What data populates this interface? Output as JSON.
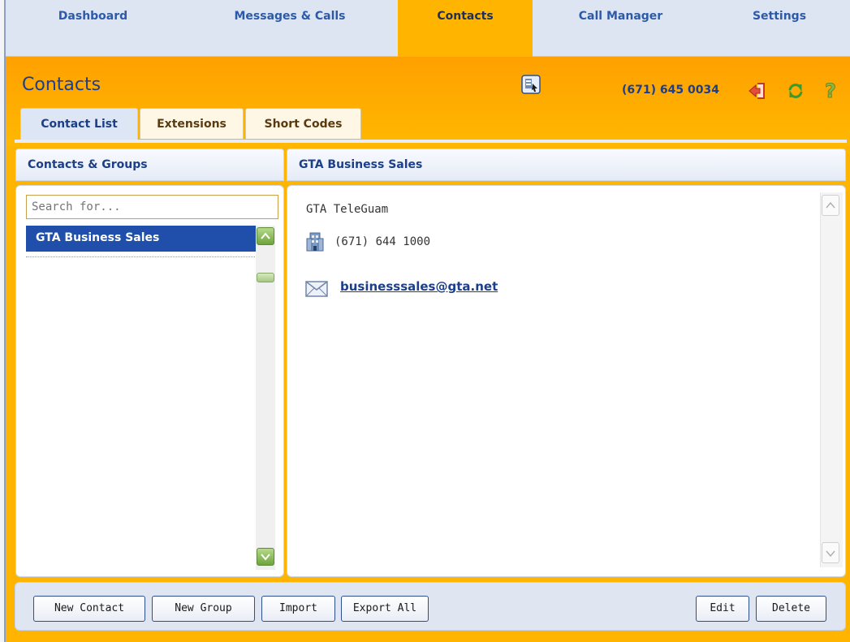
{
  "nav": {
    "tabs": [
      {
        "label": "Dashboard"
      },
      {
        "label": "Messages & Calls"
      },
      {
        "label": "Contacts"
      },
      {
        "label": "Call Manager"
      },
      {
        "label": "Settings"
      }
    ],
    "active": "Contacts"
  },
  "header": {
    "title": "Contacts",
    "phone": "(671) 645 0034",
    "icons": [
      "contact-card-icon",
      "logout-icon",
      "refresh-icon",
      "help-icon"
    ]
  },
  "subtabs": [
    {
      "label": "Contact List"
    },
    {
      "label": "Extensions"
    },
    {
      "label": "Short Codes"
    }
  ],
  "left_panel": {
    "title": "Contacts & Groups",
    "search_placeholder": "Search for...",
    "items": [
      {
        "label": "GTA Business Sales",
        "selected": true
      }
    ]
  },
  "right_panel": {
    "title": "GTA Business Sales",
    "company": "GTA TeleGuam",
    "phone": "(671) 644 1000",
    "email": "businesssales@gta.net"
  },
  "toolbar": {
    "new_contact": "New Contact",
    "new_group": "New Group",
    "import": "Import",
    "export_all": "Export All",
    "edit": "Edit",
    "delete": "Delete"
  },
  "colors": {
    "accent": "#ffb400",
    "nav_bg": "#dde5f2",
    "text_blue": "#1d3f8a",
    "selected_bg": "#1f4faa"
  }
}
